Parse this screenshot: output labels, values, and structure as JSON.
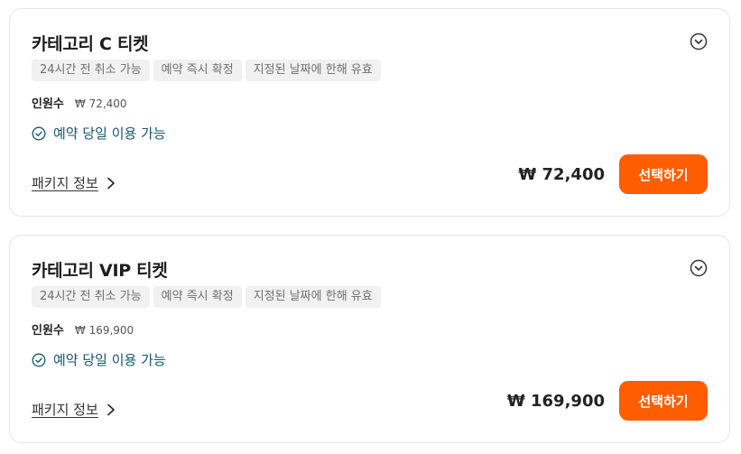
{
  "cards": [
    {
      "title": "카테고리 C 티켓",
      "tags": [
        "24시간 전 취소 가능",
        "예약 즉시 확정",
        "지정된 날짜에 한해 유효"
      ],
      "pax_label": "인원수",
      "pax_value": "₩ 72,400",
      "availability": "예약 당일 이용 가능",
      "package_link": "패키지 정보",
      "price": "₩ 72,400",
      "select_label": "선택하기"
    },
    {
      "title": "카테고리 VIP 티켓",
      "tags": [
        "24시간 전 취소 가능",
        "예약 즉시 확정",
        "지정된 날짜에 한해 유효"
      ],
      "pax_label": "인원수",
      "pax_value": "₩ 169,900",
      "availability": "예약 당일 이용 가능",
      "package_link": "패키지 정보",
      "price": "₩ 169,900",
      "select_label": "선택하기"
    }
  ],
  "colors": {
    "accent": "#ff5d00",
    "availability_text": "#16576a",
    "tag_bg": "#f1f1f1"
  },
  "icons": {
    "toggle": "chevron-down-circle-icon",
    "availability": "check-circle-icon",
    "package": "chevron-right-icon"
  }
}
